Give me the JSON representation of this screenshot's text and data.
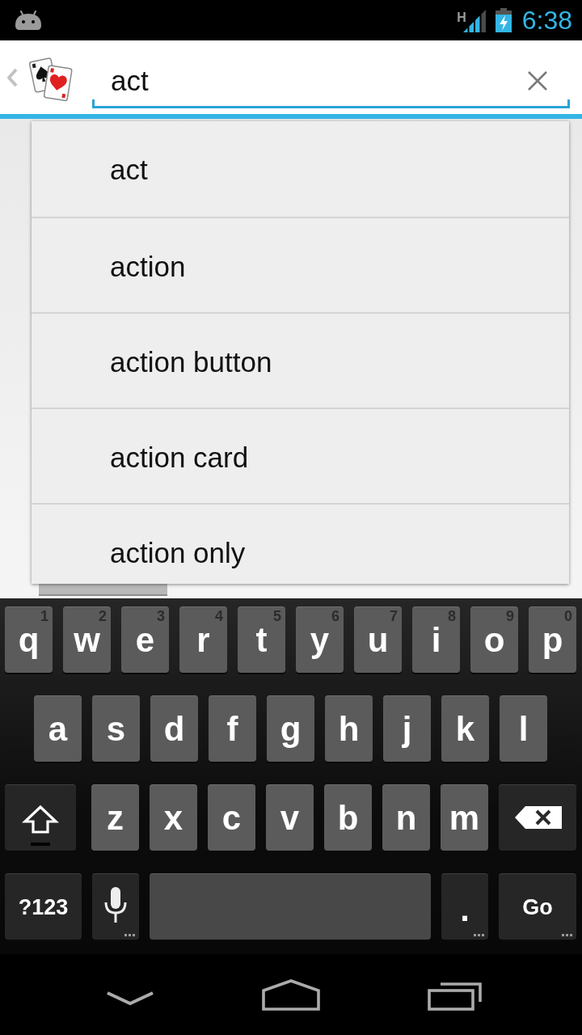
{
  "status_bar": {
    "network_type": "H",
    "time": "6:38"
  },
  "search": {
    "value": "act"
  },
  "suggestions": [
    "act",
    "action",
    "action button",
    "action card",
    "action only"
  ],
  "keyboard": {
    "rows": [
      [
        {
          "kind": "letter",
          "label": "q",
          "hint": "1"
        },
        {
          "kind": "letter",
          "label": "w",
          "hint": "2"
        },
        {
          "kind": "letter",
          "label": "e",
          "hint": "3"
        },
        {
          "kind": "letter",
          "label": "r",
          "hint": "4"
        },
        {
          "kind": "letter",
          "label": "t",
          "hint": "5"
        },
        {
          "kind": "letter",
          "label": "y",
          "hint": "6"
        },
        {
          "kind": "letter",
          "label": "u",
          "hint": "7"
        },
        {
          "kind": "letter",
          "label": "i",
          "hint": "8"
        },
        {
          "kind": "letter",
          "label": "o",
          "hint": "9"
        },
        {
          "kind": "letter",
          "label": "p",
          "hint": "0"
        }
      ],
      [
        {
          "kind": "letter",
          "label": "a"
        },
        {
          "kind": "letter",
          "label": "s"
        },
        {
          "kind": "letter",
          "label": "d"
        },
        {
          "kind": "letter",
          "label": "f"
        },
        {
          "kind": "letter",
          "label": "g"
        },
        {
          "kind": "letter",
          "label": "h"
        },
        {
          "kind": "letter",
          "label": "j"
        },
        {
          "kind": "letter",
          "label": "k"
        },
        {
          "kind": "letter",
          "label": "l"
        }
      ],
      [
        {
          "kind": "shift"
        },
        {
          "kind": "letter",
          "label": "z"
        },
        {
          "kind": "letter",
          "label": "x"
        },
        {
          "kind": "letter",
          "label": "c"
        },
        {
          "kind": "letter",
          "label": "v"
        },
        {
          "kind": "letter",
          "label": "b"
        },
        {
          "kind": "letter",
          "label": "n"
        },
        {
          "kind": "letter",
          "label": "m"
        },
        {
          "kind": "delete"
        }
      ]
    ],
    "bottom_row": {
      "symbols_key": {
        "label": "?123"
      },
      "voice_key": {
        "more_keys": true
      },
      "period_key": {
        "label": ".",
        "more_keys": true
      },
      "go_key": {
        "label": "Go",
        "more_keys": true
      }
    }
  }
}
